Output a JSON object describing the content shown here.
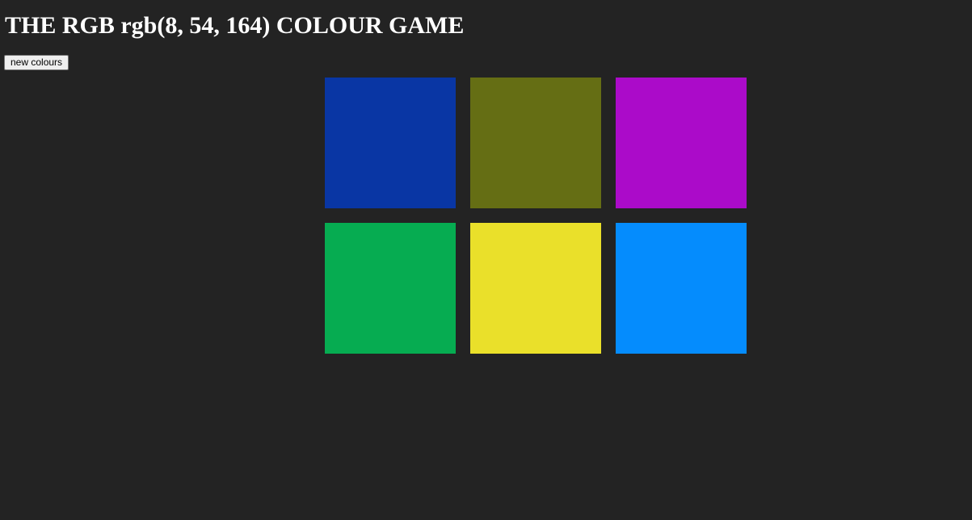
{
  "game": {
    "title": "THE RGB rgb(8, 54, 164) COLOUR GAME",
    "target_colour": "rgb(8, 54, 164)",
    "new_colours_label": "new colours"
  },
  "squares": [
    {
      "color": "#0936A4"
    },
    {
      "color": "#656E14"
    },
    {
      "color": "#AB0BC9"
    },
    {
      "color": "#06AC51"
    },
    {
      "color": "#EAE02A"
    },
    {
      "color": "#058CFD"
    }
  ],
  "colors": {
    "background": "#232323",
    "title_text": "#FFFFFF"
  }
}
